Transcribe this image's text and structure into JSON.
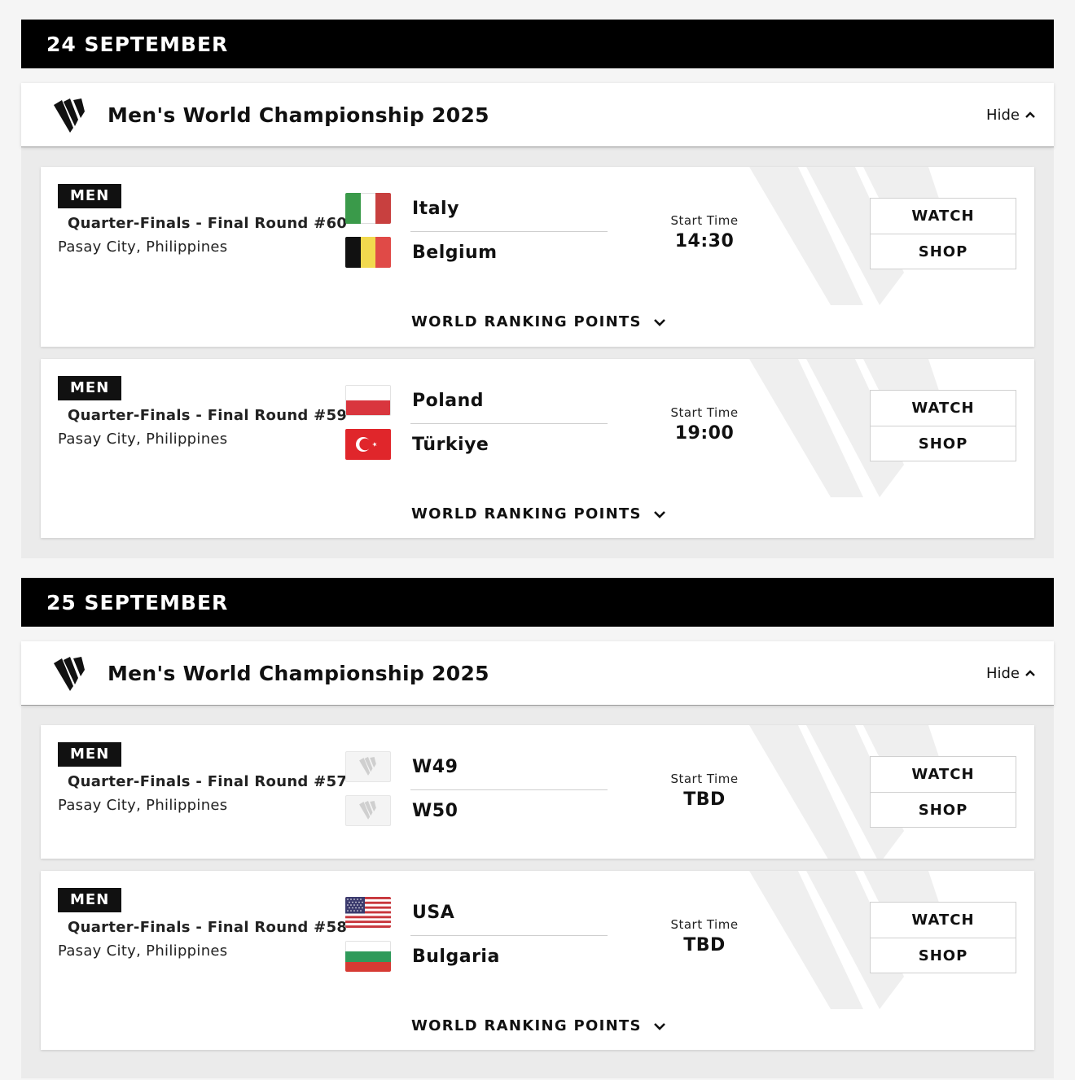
{
  "days": [
    {
      "date": "24 SEPTEMBER",
      "competition": {
        "title": "Men's World Championship 2025",
        "toggle": "Hide"
      },
      "matches": [
        {
          "gender": "MEN",
          "round": "Quarter-Finals - Final Round #60",
          "venue": "Pasay City, Philippines",
          "team1": {
            "name": "Italy",
            "flag": "italy-flag"
          },
          "team2": {
            "name": "Belgium",
            "flag": "belgium-flag"
          },
          "start_label": "Start Time",
          "start_time": "14:30",
          "watch": "WATCH",
          "shop": "SHOP",
          "wrp": "WORLD RANKING POINTS"
        },
        {
          "gender": "MEN",
          "round": "Quarter-Finals - Final Round #59",
          "venue": "Pasay City, Philippines",
          "team1": {
            "name": "Poland",
            "flag": "poland-flag"
          },
          "team2": {
            "name": "Türkiye",
            "flag": "turkiye-flag"
          },
          "start_label": "Start Time",
          "start_time": "19:00",
          "watch": "WATCH",
          "shop": "SHOP",
          "wrp": "WORLD RANKING POINTS"
        }
      ]
    },
    {
      "date": "25 SEPTEMBER",
      "competition": {
        "title": "Men's World Championship 2025",
        "toggle": "Hide"
      },
      "matches": [
        {
          "gender": "MEN",
          "round": "Quarter-Finals - Final Round #57",
          "venue": "Pasay City, Philippines",
          "team1": {
            "name": "W49",
            "flag": "placeholder-logo"
          },
          "team2": {
            "name": "W50",
            "flag": "placeholder-logo"
          },
          "start_label": "Start Time",
          "start_time": "TBD",
          "watch": "WATCH",
          "shop": "SHOP"
        },
        {
          "gender": "MEN",
          "round": "Quarter-Finals - Final Round #58",
          "venue": "Pasay City, Philippines",
          "team1": {
            "name": "USA",
            "flag": "usa-flag"
          },
          "team2": {
            "name": "Bulgaria",
            "flag": "bulgaria-flag"
          },
          "start_label": "Start Time",
          "start_time": "TBD",
          "watch": "WATCH",
          "shop": "SHOP",
          "wrp": "WORLD RANKING POINTS"
        }
      ]
    }
  ]
}
